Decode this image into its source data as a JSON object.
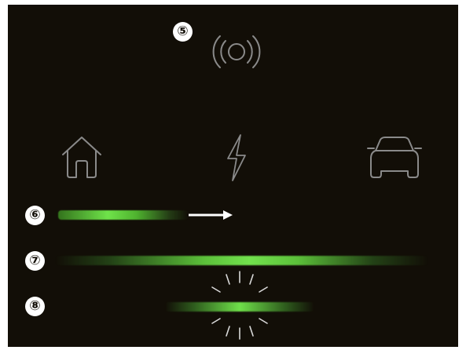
{
  "markers": {
    "m5": "⑤",
    "m6": "⑥",
    "m7": "⑦",
    "m8": "⑧"
  },
  "icons": {
    "top": "wireless-signal-icon",
    "home": "house-icon",
    "power": "lightning-bolt-icon",
    "vehicle": "car-icon",
    "direction": "right-arrow-icon",
    "sparkle_top": "sparkle-rays-icon",
    "sparkle_bottom": "sparkle-rays-icon"
  },
  "bars": {
    "bar_6": "charging-progress-bar",
    "bar_7": "full-width-charging-bar",
    "bar_8": "pulsing-charging-bar"
  },
  "colors": {
    "background": "#120e07",
    "icon_stroke": "#8a8a8a",
    "green": "#6fe34a",
    "marker": "#ffffff",
    "arrow": "#ffffff"
  }
}
